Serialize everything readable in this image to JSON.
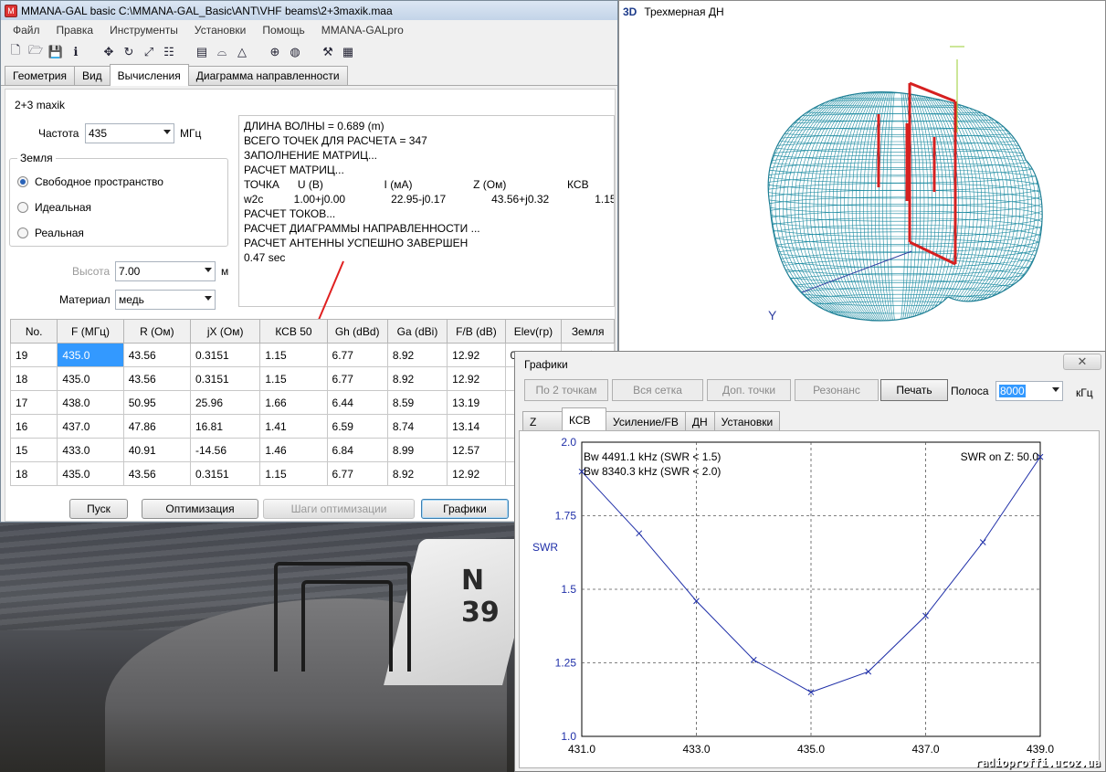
{
  "main_window": {
    "title": "MMANA-GAL basic C:\\MMANA-GAL_Basic\\ANT\\VHF beams\\2+3maxik.maa",
    "menu": [
      "Файл",
      "Правка",
      "Инструменты",
      "Установки",
      "Помощь",
      "MMANA-GALpro"
    ],
    "tabs": [
      "Геометрия",
      "Вид",
      "Вычисления",
      "Диаграмма направленности"
    ],
    "active_tab": "Вычисления",
    "antenna_name": "2+3 maxik",
    "freq_label": "Частота",
    "freq_value": "435",
    "freq_unit": "МГц",
    "ground_group": "Земля",
    "ground_options": [
      "Свободное пространство",
      "Идеальная",
      "Реальная"
    ],
    "height_label": "Высота",
    "height_value": "7.00",
    "height_unit": "м",
    "material_label": "Материал",
    "material_value": "медь",
    "log": [
      "ДЛИНА ВОЛНЫ = 0.689 (m)",
      "ВСЕГО ТОЧЕК ДЛЯ РАСЧЕТА = 347",
      "ЗАПОЛНЕНИЕ МАТРИЦ...",
      "РАСЧЕТ МАТРИЦ...",
      "ТОЧКА      U (В)                    I (мА)                    Z (Ом)                    КСВ",
      "w2c          1.00+j0.00               22.95-j0.17               43.56+j0.32               1.15",
      "РАСЧЕТ ТОКОВ...",
      "РАСЧЕТ ДИАГРАММЫ НАПРАВЛЕННОСТИ ...",
      "РАСЧЕТ АНТЕННЫ УСПЕШНО ЗАВЕРШЕН",
      "0.47 sec"
    ],
    "table": {
      "headers": [
        "No.",
        "F (МГц)",
        "R (Ом)",
        "jX (Ом)",
        "КСВ 50",
        "Gh (dBd)",
        "Ga (dBi)",
        "F/B (dB)",
        "Elev(гр)",
        "Земля"
      ],
      "rows": [
        [
          "19",
          "435.0",
          "43.56",
          "0.3151",
          "1.15",
          "6.77",
          "8.92",
          "12.92",
          "0.0",
          "Своб."
        ],
        [
          "18",
          "435.0",
          "43.56",
          "0.3151",
          "1.15",
          "6.77",
          "8.92",
          "12.92",
          "",
          ""
        ],
        [
          "17",
          "438.0",
          "50.95",
          "25.96",
          "1.66",
          "6.44",
          "8.59",
          "13.19",
          "",
          ""
        ],
        [
          "16",
          "437.0",
          "47.86",
          "16.81",
          "1.41",
          "6.59",
          "8.74",
          "13.14",
          "",
          ""
        ],
        [
          "15",
          "433.0",
          "40.91",
          "-14.56",
          "1.46",
          "6.84",
          "8.99",
          "12.57",
          "",
          ""
        ],
        [
          "18",
          "435.0",
          "43.56",
          "0.3151",
          "1.15",
          "6.77",
          "8.92",
          "12.92",
          "",
          ""
        ]
      ]
    },
    "buttons": {
      "start": "Пуск",
      "optimize": "Оптимизация",
      "steps": "Шаги оптимизации",
      "graphs": "Графики"
    }
  },
  "window_3d": {
    "tag": "3D",
    "title": "Трехмерная ДН",
    "axis_y": "Y"
  },
  "graphs_window": {
    "title": "Графики",
    "close": "✕",
    "buttons": [
      "По 2 точкам",
      "Вся сетка",
      "Доп. точки",
      "Резонанс",
      "Печать"
    ],
    "band_label": "Полоса",
    "band_value": "8000",
    "band_unit": "кГц",
    "tabs": [
      "Z",
      "КСВ",
      "Усиление/FB",
      "ДН",
      "Установки"
    ],
    "active_tab": "КСВ",
    "bw1": "Bw 4491.1 kHz (SWR < 1.5)",
    "bw2": "Bw 8340.3 kHz (SWR < 2.0)",
    "swr_on": "SWR on Z: 50.0",
    "ylabel": "SWR"
  },
  "chart_data": {
    "type": "line",
    "x": [
      431.0,
      432.0,
      433.0,
      434.0,
      435.0,
      436.0,
      437.0,
      438.0,
      439.0
    ],
    "series": [
      {
        "values": [
          1.9,
          1.69,
          1.46,
          1.26,
          1.15,
          1.22,
          1.41,
          1.66,
          1.95
        ]
      }
    ],
    "xlim": [
      431.0,
      439.0
    ],
    "ylim": [
      1.0,
      2.0
    ],
    "xticks": [
      "431.0",
      "433.0",
      "435.0",
      "437.0",
      "439.0"
    ],
    "yticks": [
      "2.0",
      "1.75",
      "1.5",
      "1.25",
      "1.0"
    ],
    "xtick_values": [
      431,
      433,
      435,
      437,
      439
    ],
    "ytick_values": [
      2.0,
      1.75,
      1.5,
      1.25,
      1.0
    ],
    "line_color": "#1f2fa8",
    "grid": true
  },
  "watermark": "radioproffi.ucoz.ua"
}
